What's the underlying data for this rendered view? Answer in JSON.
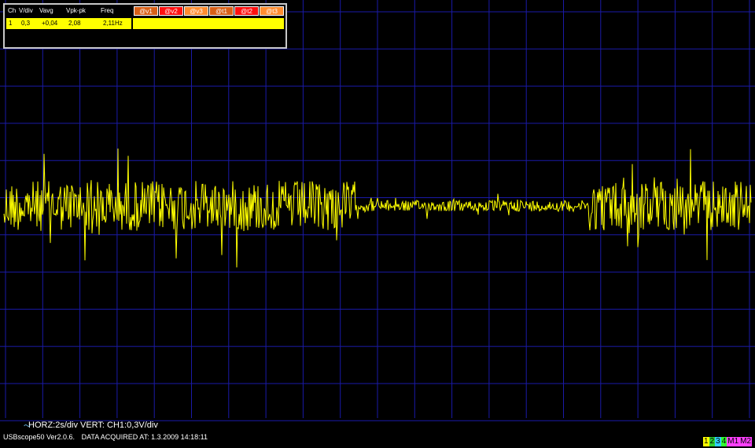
{
  "window": {
    "background": "#000000",
    "grid_color": "#1a1aa8",
    "trace_color": "#ffff00"
  },
  "measurements": {
    "headers": [
      "Ch",
      "V/div",
      "Vavg",
      "Vpk-pk",
      "Freq"
    ],
    "marker_buttons": [
      {
        "label": "@v1",
        "color": "#d86018"
      },
      {
        "label": "@v2",
        "color": "#ff1010"
      },
      {
        "label": "@v3",
        "color": "#ff8c30"
      },
      {
        "label": "@t1",
        "color": "#d86018"
      },
      {
        "label": "@t2",
        "color": "#ff1010"
      },
      {
        "label": "@t3",
        "color": "#ff8c30"
      }
    ],
    "row": {
      "ch": "1",
      "vdiv": "0,3",
      "vavg": "+0,04",
      "vpkpk": "2,08",
      "freq": "2,11Hz"
    }
  },
  "chart_data": {
    "type": "line",
    "series": [
      {
        "description_of_shape": "noise",
        "color": "#ffff00"
      }
    ],
    "x_divisions": 20,
    "y_divisions": 11,
    "horizontal_scale": "2s/div",
    "vertical_scale": "0,3V/div",
    "quiet_segment": [
      0.47,
      0.78
    ]
  },
  "status": {
    "line1": "HORZ:2s/div VERT: CH1:0,3V/div",
    "version": "USBscope50 Ver2.0.6.",
    "acquired": "DATA ACQUIRED AT: 1.3.2009 14:18:11"
  },
  "channel_selector": [
    {
      "label": "1",
      "color": "#ffff00"
    },
    {
      "label": "2",
      "color": "#30d030"
    },
    {
      "label": "3",
      "color": "#30d0ff"
    },
    {
      "label": "4",
      "color": "#30ff30"
    },
    {
      "label": "M1",
      "color": "#ff40ff"
    },
    {
      "label": "M2",
      "color": "#ff40ff"
    }
  ]
}
